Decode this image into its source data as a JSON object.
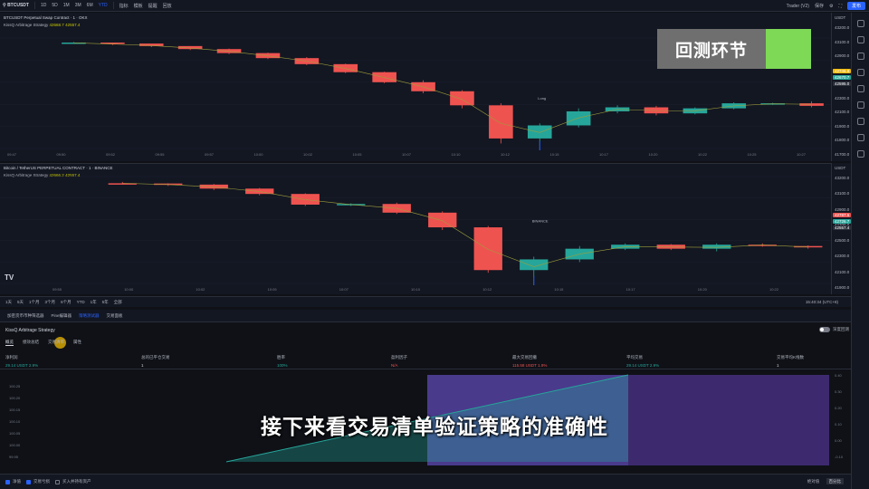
{
  "topbar": {
    "symbol": "BTCUSDT",
    "intervals": [
      "1D",
      "5D",
      "1M",
      "3M",
      "6M",
      "YTD"
    ],
    "items": [
      "指标",
      "模板",
      "提醒",
      "回放"
    ],
    "right": [
      "Trader (V2)",
      "保存"
    ],
    "share": "发布"
  },
  "pane1": {
    "title": "BTCUSDT Perpetual Swap Contract · 1 · OKX",
    "strategy": "KissQ Arbitrage Strategy",
    "strategy_val": "42668.7  42557.4",
    "price_labels": [
      "43200.0",
      "43100.0",
      "42900.0",
      "42700.0",
      "42500.0",
      "42300.0",
      "42100.0",
      "41900.0",
      "41800.0",
      "41700.0"
    ],
    "tags": [
      {
        "text": "42746.8",
        "color": "#f0b90b"
      },
      {
        "text": "42670.7",
        "color": "#26a69a"
      },
      {
        "text": "42595.0",
        "color": "#2a2e39"
      }
    ],
    "currency": "USDT",
    "times": [
      "09:47",
      "09:50",
      "09:52",
      "09:55",
      "09:57",
      "10:00",
      "10:02",
      "10:05",
      "10:07",
      "10:10",
      "10:12",
      "10:15",
      "10:17",
      "10:20",
      "10:22",
      "10:25",
      "10:27"
    ],
    "trade_label": "Long",
    "trade_label2": "-0.755855"
  },
  "pane2": {
    "title": "Bitcoin / TetherUS PERPETUAL CONTRACT · 1 · BINANCE",
    "strategy": "KissQ Arbitrage Strategy",
    "strategy_val": "42666.2  42557.4",
    "price_labels": [
      "43200.0",
      "43100.0",
      "42900.0",
      "42700.0",
      "42500.0",
      "42300.0",
      "42100.0",
      "41900.0"
    ],
    "tags": [
      {
        "text": "42787.5",
        "color": "#ef5350"
      },
      {
        "text": "42726.7",
        "color": "#26a69a"
      },
      {
        "text": "42557.4",
        "color": "#2a2e39"
      }
    ],
    "currency": "USDT",
    "times": [
      "09:55",
      "10:00",
      "10:02",
      "10:05",
      "10:07",
      "10:10",
      "10:12",
      "10:15",
      "10:17",
      "10:20",
      "10:22"
    ],
    "trade_label": "BINANCE",
    "trade_label2": "-0.755855"
  },
  "range_bar": {
    "ranges": [
      "1天",
      "5天",
      "1个月",
      "3个月",
      "6个月",
      "YTD",
      "1年",
      "5年",
      "全部"
    ],
    "clock": "15:40:34 (UTC+8)"
  },
  "panel_tabs": [
    "加密货币币种筛选器",
    "Pine编辑器",
    "策略测试器",
    "交易面板"
  ],
  "panel_active": 2,
  "strategy_header": "KissQ Arbitrage Strategy",
  "deep_backtest": "深度回测",
  "sub_tabs": [
    "概览",
    "绩效总结",
    "交易清单",
    "属性"
  ],
  "sub_active": 0,
  "metrics": [
    {
      "label": "净利润",
      "value": "29.14 USDT  2.9%",
      "color": "#26a69a"
    },
    {
      "label": "总的已平仓交易",
      "value": "1",
      "color": "#d1d4dc"
    },
    {
      "label": "胜率",
      "value": "100%",
      "color": "#26a69a"
    },
    {
      "label": "盈利因子",
      "value": "N/A",
      "color": "#ef5350"
    },
    {
      "label": "最大交易回撤",
      "value": "115.58 USDT  1.9%",
      "color": "#ef5350"
    },
    {
      "label": "平均交易",
      "value": "29.14 USDT  2.9%",
      "color": "#26a69a"
    },
    {
      "label": "交易平均K线数",
      "value": "1",
      "color": "#d1d4dc"
    }
  ],
  "equity": {
    "y_left": [
      "100.25",
      "100.20",
      "100.15",
      "100.10",
      "100.05",
      "100.00",
      "99.95"
    ],
    "y_right": [
      "0.40",
      "0.30",
      "0.20",
      "0.10",
      "0.00",
      "-0.10"
    ],
    "x_labels": [
      "1",
      "2"
    ]
  },
  "bottom": {
    "checks": [
      {
        "label": "净值",
        "on": true
      },
      {
        "label": "交易亏损",
        "on": true
      },
      {
        "label": "买入并持有资产",
        "on": false
      }
    ],
    "right": [
      "绝对值",
      "百分比"
    ]
  },
  "caption_box": "回测环节",
  "subtitle": "接下来看交易清单验证策略的准确性",
  "chart_data": [
    {
      "type": "candlestick",
      "title": "BTCUSDT Perpetual Swap Contract · 1 · OKX",
      "ohlc": [
        [
          42600,
          42610,
          42595,
          42605
        ],
        [
          42605,
          42600,
          42580,
          42595
        ],
        [
          42595,
          42590,
          42560,
          42570
        ],
        [
          42570,
          42570,
          42530,
          42540
        ],
        [
          42540,
          42545,
          42490,
          42500
        ],
        [
          42500,
          42505,
          42440,
          42450
        ],
        [
          42450,
          42460,
          42380,
          42390
        ],
        [
          42390,
          42395,
          42300,
          42310
        ],
        [
          42310,
          42315,
          42200,
          42210
        ],
        [
          42210,
          42230,
          42100,
          42120
        ],
        [
          42120,
          42130,
          41950,
          41980
        ],
        [
          41980,
          42000,
          41600,
          41650
        ],
        [
          41650,
          41800,
          41620,
          41780
        ],
        [
          41780,
          41950,
          41760,
          41920
        ],
        [
          41920,
          41980,
          41900,
          41960
        ],
        [
          41960,
          41975,
          41880,
          41900
        ],
        [
          41900,
          41960,
          41890,
          41950
        ],
        [
          41950,
          42010,
          41940,
          42000
        ],
        [
          42000,
          42005,
          41985,
          42000
        ],
        [
          42000,
          42020,
          41960,
          41975
        ]
      ]
    },
    {
      "type": "candlestick",
      "title": "Bitcoin / TetherUS PERPETUAL CONTRACT · 1 · BINANCE",
      "ohlc": [
        [
          42650,
          42660,
          42640,
          42648
        ],
        [
          42648,
          42650,
          42630,
          42640
        ],
        [
          42640,
          42645,
          42600,
          42610
        ],
        [
          42610,
          42615,
          42560,
          42570
        ],
        [
          42570,
          42575,
          42480,
          42490
        ],
        [
          42490,
          42500,
          42480,
          42495
        ],
        [
          42495,
          42505,
          42420,
          42430
        ],
        [
          42430,
          42440,
          42300,
          42320
        ],
        [
          42320,
          42330,
          41980,
          42000
        ],
        [
          42000,
          42100,
          41950,
          42080
        ],
        [
          42080,
          42180,
          42060,
          42160
        ],
        [
          42160,
          42200,
          42150,
          42190
        ],
        [
          42190,
          42195,
          42150,
          42160
        ],
        [
          42160,
          42200,
          42140,
          42190
        ],
        [
          42190,
          42200,
          42175,
          42180
        ],
        [
          42180,
          42185,
          42160,
          42170
        ]
      ]
    },
    {
      "type": "area",
      "title": "",
      "x": [
        1,
        2
      ],
      "values": [
        99.95,
        100.25
      ]
    }
  ]
}
